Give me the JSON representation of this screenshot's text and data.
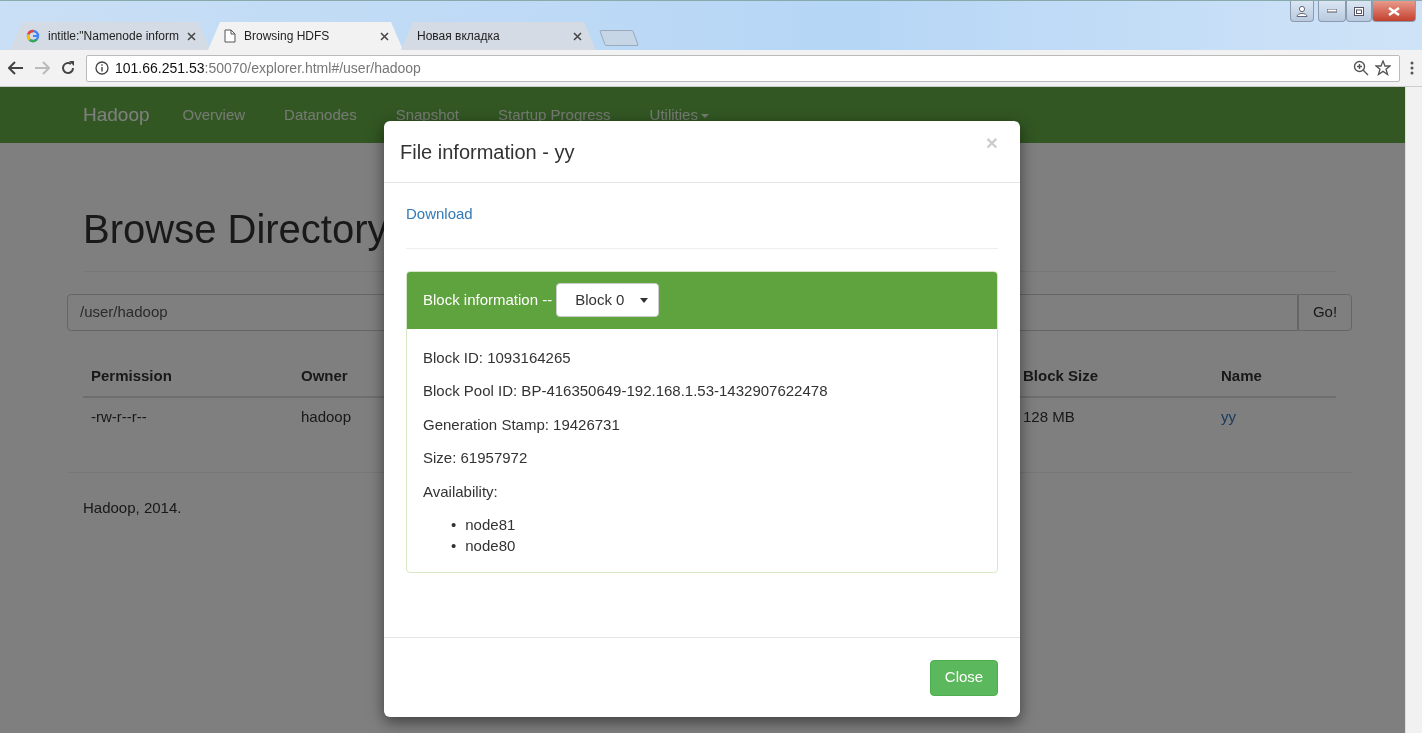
{
  "browser": {
    "tabs": [
      {
        "title": "intitle:\"Namenode inform",
        "kind": "google",
        "selected": false
      },
      {
        "title": "Browsing HDFS",
        "kind": "page",
        "selected": true
      },
      {
        "title": "Новая вкладка",
        "kind": "plain",
        "selected": false
      }
    ],
    "address": {
      "host": "101.66.251.53",
      "path": ":50070/explorer.html#/user/hadoop"
    }
  },
  "navbar": {
    "brand": "Hadoop",
    "items": [
      {
        "label": "Overview",
        "dropdown": false
      },
      {
        "label": "Datanodes",
        "dropdown": false
      },
      {
        "label": "Snapshot",
        "dropdown": false
      },
      {
        "label": "Startup Progress",
        "dropdown": false
      },
      {
        "label": "Utilities",
        "dropdown": true
      }
    ]
  },
  "page": {
    "heading": "Browse Directory",
    "path_field": {
      "value": "/user/hadoop"
    },
    "go_button": "Go!",
    "table": {
      "columns": [
        "Permission",
        "Owner",
        "Block Size",
        "Name"
      ],
      "rows": [
        {
          "cells": [
            {
              "text": "-rw-r--r--",
              "link": false
            },
            {
              "text": "hadoop",
              "link": false
            },
            {
              "text": "128 MB",
              "link": false
            },
            {
              "text": "yy",
              "link": true
            }
          ]
        }
      ]
    },
    "footer": "Hadoop, 2014."
  },
  "modal": {
    "title": "File information - yy",
    "close": "×",
    "download": "Download",
    "block_panel": {
      "label": "Block information --",
      "select": "Block 0",
      "fields": [
        "Block ID: 1093164265",
        "Block Pool ID: BP-416350649-192.168.1.53-1432907622478",
        "Generation Stamp: 19426731",
        "Size: 61957972"
      ],
      "availability_label": "Availability:",
      "nodes": [
        {
          "marker": "•",
          "text": "node81"
        },
        {
          "marker": "•",
          "text": "node80"
        }
      ]
    },
    "button": "Close"
  }
}
